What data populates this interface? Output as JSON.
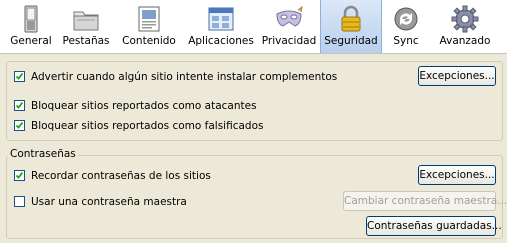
{
  "toolbar": {
    "tabs": [
      {
        "label": "General",
        "icon": "switch-icon"
      },
      {
        "label": "Pestañas",
        "icon": "folder-tabs-icon"
      },
      {
        "label": "Contenido",
        "icon": "content-icon"
      },
      {
        "label": "Aplicaciones",
        "icon": "applications-icon"
      },
      {
        "label": "Privacidad",
        "icon": "mask-icon"
      },
      {
        "label": "Seguridad",
        "icon": "padlock-icon"
      },
      {
        "label": "Sync",
        "icon": "sync-icon"
      },
      {
        "label": "Avanzado",
        "icon": "gear-icon"
      }
    ],
    "active": "Seguridad"
  },
  "security": {
    "warn_addons": {
      "label": "Advertir cuando algún sitio intente instalar complementos",
      "checked": true
    },
    "exceptions_button": "Excepciones...",
    "block_attack": {
      "label": "Bloquear sitios reportados como atacantes",
      "checked": true
    },
    "block_forgery": {
      "label": "Bloquear sitios reportados como falsificados",
      "checked": true
    }
  },
  "passwords": {
    "caption": "Contraseñas",
    "remember": {
      "label": "Recordar contraseñas de los sitios",
      "checked": true
    },
    "exceptions_button": "Excepciones...",
    "master": {
      "label": "Usar una contraseña maestra",
      "checked": false
    },
    "change_master_button": "Cambiar contraseña maestra...",
    "saved_button": "Contraseñas guardadas..."
  },
  "colors": {
    "window_bg": "#ece9d8",
    "active_tab": "#b8d0ee",
    "check_green": "#21a121"
  }
}
